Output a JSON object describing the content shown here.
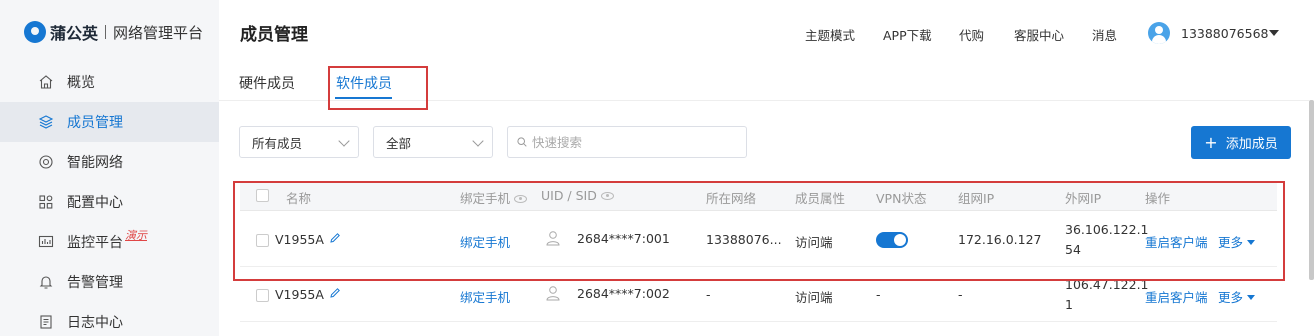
{
  "brand": {
    "name": "蒲公英",
    "subtitle": "网络管理平台"
  },
  "sidebar": {
    "items": [
      {
        "label": "概览",
        "icon": "home-icon"
      },
      {
        "label": "成员管理",
        "icon": "layers-icon",
        "active": true
      },
      {
        "label": "智能网络",
        "icon": "network-icon"
      },
      {
        "label": "配置中心",
        "icon": "grid-icon"
      },
      {
        "label": "监控平台",
        "icon": "monitor-icon",
        "badge": "演示"
      },
      {
        "label": "告警管理",
        "icon": "bell-icon"
      },
      {
        "label": "日志中心",
        "icon": "log-icon"
      }
    ]
  },
  "header": {
    "title": "成员管理",
    "nav": [
      "主题模式",
      "APP下载",
      "代购",
      "客服中心",
      "消息"
    ],
    "user": "13388076568"
  },
  "tabs": [
    {
      "label": "硬件成员",
      "active": false
    },
    {
      "label": "软件成员",
      "active": true
    }
  ],
  "filters": {
    "member_select": "所有成员",
    "status_select": "全部",
    "search_placeholder": "快速搜索",
    "add_button": "添加成员"
  },
  "table": {
    "columns": [
      "名称",
      "绑定手机",
      "UID / SID",
      "所在网络",
      "成员属性",
      "VPN状态",
      "组网IP",
      "外网IP",
      "操作"
    ],
    "rows": [
      {
        "name": "V1955A",
        "phone_action": "绑定手机",
        "uid": "2684****7:001",
        "network": "13388076...",
        "attribute": "访问端",
        "vpn_on": true,
        "lan_ip": "172.16.0.127",
        "wan_ip_line1": "36.106.122.1",
        "wan_ip_line2": "54",
        "action_restart": "重启客户端",
        "action_more": "更多"
      },
      {
        "name": "V1955A",
        "phone_action": "绑定手机",
        "uid": "2684****7:002",
        "network": "-",
        "attribute": "访问端",
        "vpn_on": false,
        "vpn_text": "-",
        "lan_ip": "-",
        "wan_ip_line1": "106.47.122.1",
        "wan_ip_line2": "1",
        "action_restart": "重启客户端",
        "action_more": "更多"
      }
    ]
  },
  "colors": {
    "accent": "#1677d2",
    "highlight_box": "#d43c3c",
    "sidebar_bg": "#f5f6f8"
  }
}
